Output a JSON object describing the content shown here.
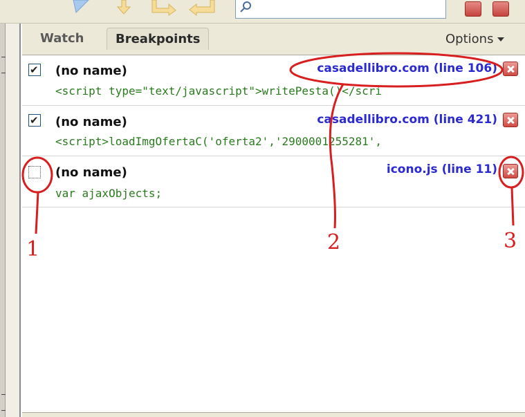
{
  "toolbar": {
    "search": {
      "value": "",
      "placeholder": ""
    },
    "icons": [
      "play-icon",
      "step-over-icon",
      "step-into-icon",
      "step-out-icon",
      "magnifier-icon",
      "close-icon",
      "close-icon"
    ]
  },
  "tabs": [
    {
      "label": "Watch",
      "active": false
    },
    {
      "label": "Breakpoints",
      "active": true
    }
  ],
  "options_label": "Options",
  "breakpoints": [
    {
      "checked": true,
      "name": "(no name)",
      "location": "casadellibro.com (line 106)",
      "code": "<script type=\"text/javascript\">writePesta()</scri"
    },
    {
      "checked": true,
      "name": "(no name)",
      "location": "casadellibro.com (line 421)",
      "code": "<script>loadImgOfertaC('oferta2','2900001255281',"
    },
    {
      "checked": false,
      "name": "(no name)",
      "location": "icono.js (line 11)",
      "code": "var ajaxObjects;"
    }
  ],
  "annotations": {
    "labels": [
      "1",
      "2",
      "3"
    ],
    "color": "#d81e1e"
  },
  "colors": {
    "panel": "#ece9d8",
    "link": "#2a2ad0",
    "code": "#2a7a1e",
    "delete": "#cf4b44"
  }
}
